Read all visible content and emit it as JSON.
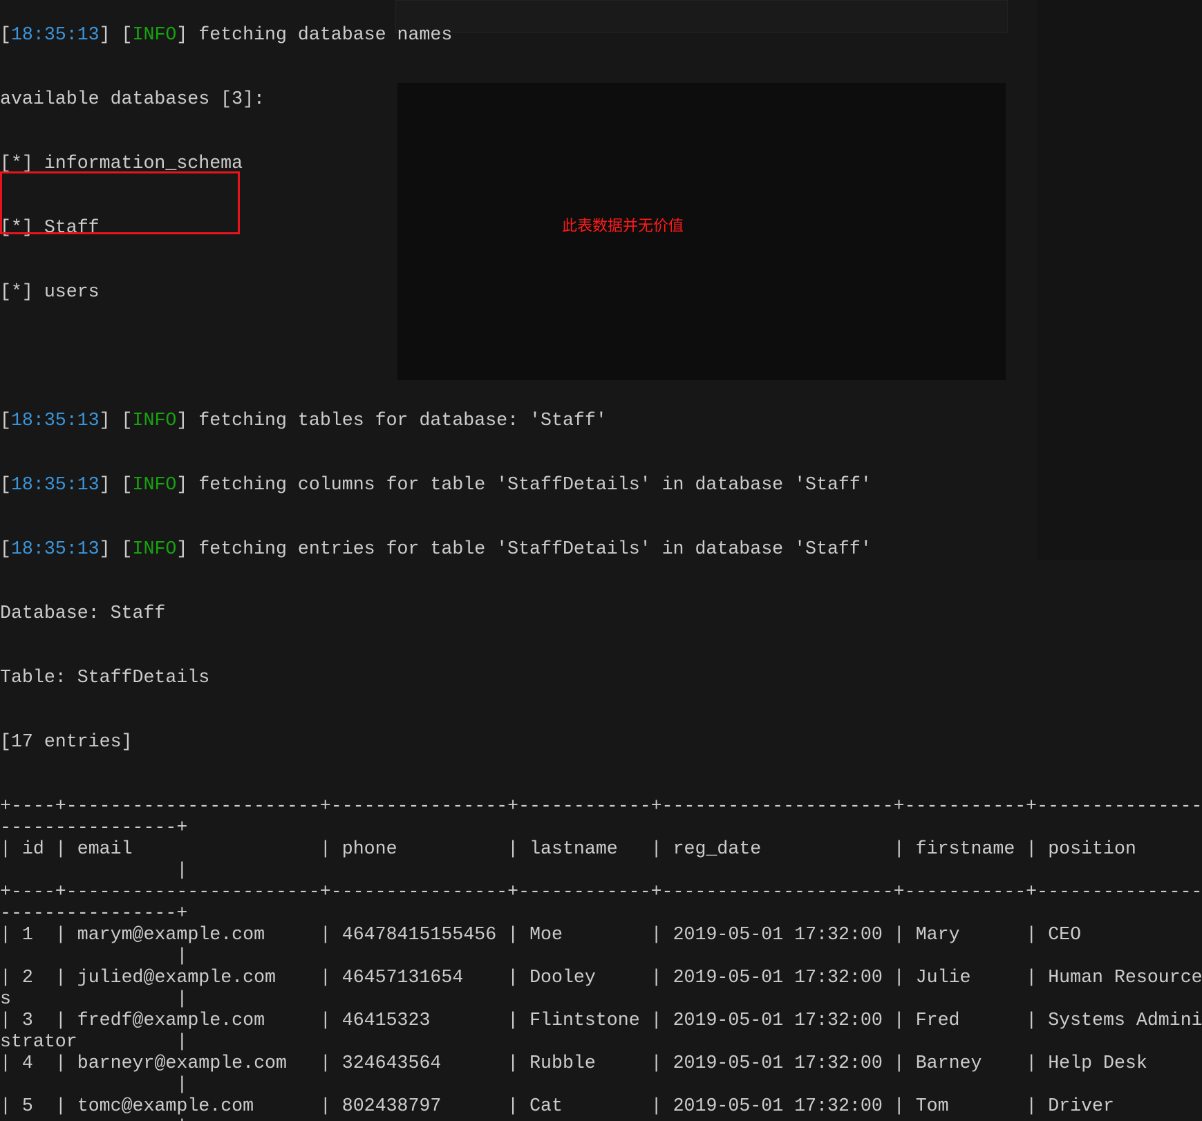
{
  "colors": {
    "text": "#cccccc",
    "timestamp": "#3a96dd",
    "info": "#16a30e",
    "annotation": "#e8141b",
    "background": "#171717"
  },
  "log_top": {
    "time": "18:35:13",
    "level": "INFO",
    "message": "fetching database names"
  },
  "databases": {
    "header": "available databases [3]:",
    "items": [
      "[*] information_schema",
      "[*] Staff",
      "[*] users"
    ]
  },
  "logs": [
    {
      "time": "18:35:13",
      "level": "INFO",
      "message": "fetching tables for database: 'Staff'"
    },
    {
      "time": "18:35:13",
      "level": "INFO",
      "message": "fetching columns for table 'StaffDetails' in database 'Staff'"
    },
    {
      "time": "18:35:13",
      "level": "INFO",
      "message": "fetching entries for table 'StaffDetails' in database 'Staff'"
    }
  ],
  "dump": {
    "database": "Database: Staff",
    "table": "Table: StaffDetails",
    "entries": "[17 entries]"
  },
  "annotation": "此表数据并无价值",
  "table": {
    "columns": [
      "id",
      "email",
      "phone",
      "lastname",
      "reg_date",
      "firstname",
      "position"
    ],
    "rows": [
      [
        "1",
        "marym@example.com",
        "46478415155456",
        "Moe",
        "2019-05-01 17:32:00",
        "Mary",
        "CEO"
      ],
      [
        "2",
        "julied@example.com",
        "46457131654",
        "Dooley",
        "2019-05-01 17:32:00",
        "Julie",
        "Human Resources"
      ],
      [
        "3",
        "fredf@example.com",
        "46415323",
        "Flintstone",
        "2019-05-01 17:32:00",
        "Fred",
        "Systems Administrator"
      ],
      [
        "4",
        "barneyr@example.com",
        "324643564",
        "Rubble",
        "2019-05-01 17:32:00",
        "Barney",
        "Help Desk"
      ],
      [
        "5",
        "tomc@example.com",
        "802438797",
        "Cat",
        "2019-05-01 17:32:00",
        "Tom",
        "Driver"
      ]
    ]
  }
}
